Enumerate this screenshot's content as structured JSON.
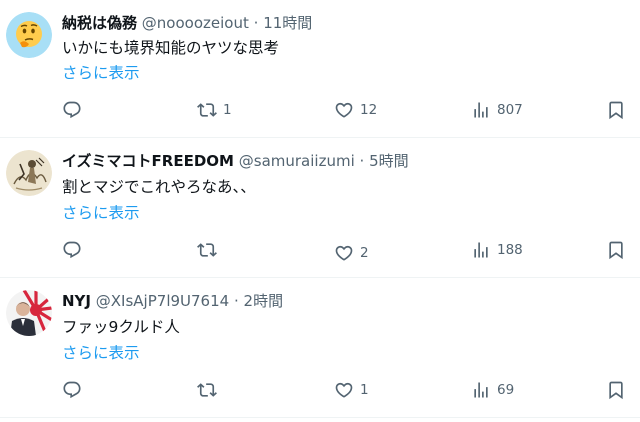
{
  "tweets": [
    {
      "name": "納税は偽務",
      "handle": "@noooozeiout",
      "separator": "·",
      "time": "11時間",
      "text": "いかにも境界知能のヤツな思考",
      "more": "さらに表示",
      "replies": "",
      "retweets": "1",
      "likes": "12",
      "views": "807"
    },
    {
      "name": "イズミマコトFREEDOM",
      "handle": "@samuraiizumi",
      "separator": "·",
      "time": "5時間",
      "text": "割とマジでこれやろなあ、、",
      "more": "さらに表示",
      "replies": "",
      "retweets": "",
      "likes": "2",
      "views": "188"
    },
    {
      "name": "NYJ",
      "handle": "@XIsAjP7l9U7614",
      "separator": "·",
      "time": "2時間",
      "text": "ファッ9クルド人",
      "more": "さらに表示",
      "replies": "",
      "retweets": "",
      "likes": "1",
      "views": "69"
    }
  ],
  "icons": {
    "reply": "reply-icon",
    "retweet": "retweet-icon",
    "like": "heart-icon",
    "views": "views-icon",
    "bookmark": "bookmark-icon"
  },
  "colors": {
    "link": "#1d9bf0",
    "secondary_text": "#536471",
    "divider": "#eff3f4"
  }
}
